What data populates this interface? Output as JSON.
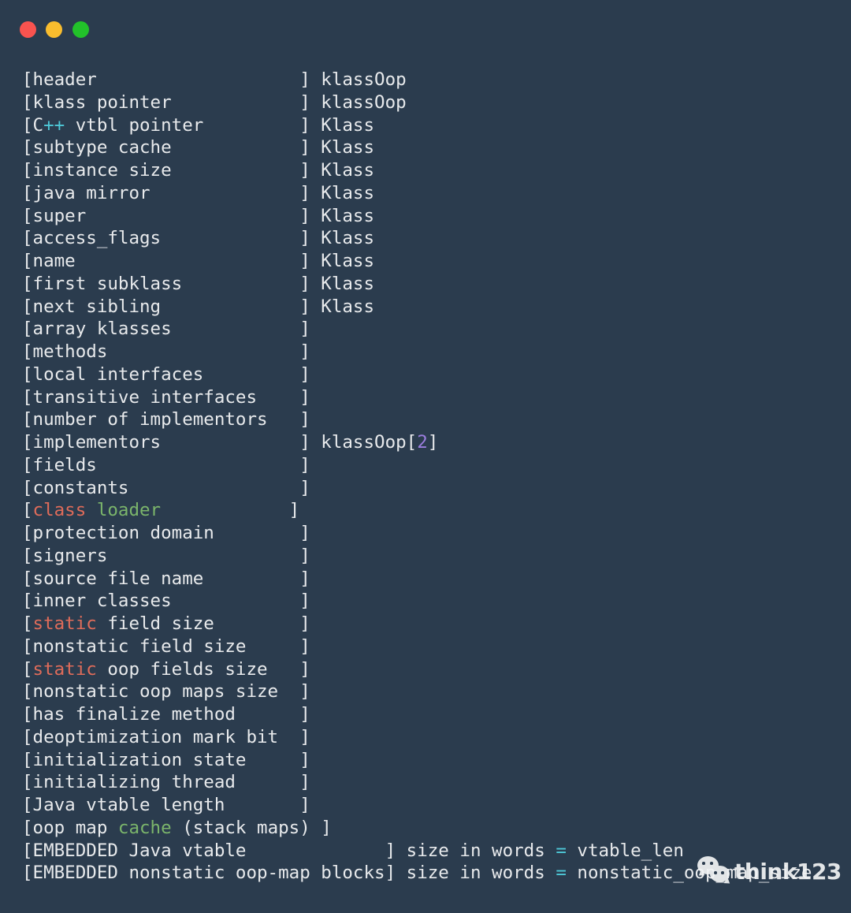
{
  "window": {
    "title": "",
    "background_color": "#2b3c4e",
    "text_color": "#e8eaec",
    "controls": {
      "close_color": "#f9534f",
      "minimize_color": "#f9bd2e",
      "maximize_color": "#22c12a",
      "close_label": "close",
      "minimize_label": "minimize",
      "maximize_label": "maximize"
    }
  },
  "colors": {
    "keyword_red": "#e06c5a",
    "keyword_green": "#7bb56b",
    "keyword_cyan": "#4ec9d8",
    "number_purple": "#9b7ede"
  },
  "terminal": {
    "lines": [
      {
        "segments": [
          {
            "t": "[header                   ] klassOop"
          }
        ]
      },
      {
        "segments": [
          {
            "t": "[klass pointer            ] klassOop"
          }
        ]
      },
      {
        "segments": [
          {
            "t": "[C"
          },
          {
            "t": "++",
            "c": "cyan"
          },
          {
            "t": " vtbl pointer         ] Klass"
          }
        ]
      },
      {
        "segments": [
          {
            "t": "[subtype cache            ] Klass"
          }
        ]
      },
      {
        "segments": [
          {
            "t": "[instance size            ] Klass"
          }
        ]
      },
      {
        "segments": [
          {
            "t": "[java mirror              ] Klass"
          }
        ]
      },
      {
        "segments": [
          {
            "t": "[super                    ] Klass"
          }
        ]
      },
      {
        "segments": [
          {
            "t": "[access_flags             ] Klass"
          }
        ]
      },
      {
        "segments": [
          {
            "t": "[name                     ] Klass"
          }
        ]
      },
      {
        "segments": [
          {
            "t": "[first subklass           ] Klass"
          }
        ]
      },
      {
        "segments": [
          {
            "t": "[next sibling             ] Klass"
          }
        ]
      },
      {
        "segments": [
          {
            "t": "[array klasses            ]"
          }
        ]
      },
      {
        "segments": [
          {
            "t": "[methods                  ]"
          }
        ]
      },
      {
        "segments": [
          {
            "t": "[local interfaces         ]"
          }
        ]
      },
      {
        "segments": [
          {
            "t": "[transitive interfaces    ]"
          }
        ]
      },
      {
        "segments": [
          {
            "t": "[number of implementors   ]"
          }
        ]
      },
      {
        "segments": [
          {
            "t": "[implementors             ] klassOop["
          },
          {
            "t": "2",
            "c": "purple"
          },
          {
            "t": "]"
          }
        ]
      },
      {
        "segments": [
          {
            "t": "[fields                   ]"
          }
        ]
      },
      {
        "segments": [
          {
            "t": "[constants                ]"
          }
        ]
      },
      {
        "segments": [
          {
            "t": "["
          },
          {
            "t": "class",
            "c": "red"
          },
          {
            "t": " "
          },
          {
            "t": "loader",
            "c": "green"
          },
          {
            "t": "            ]"
          }
        ]
      },
      {
        "segments": [
          {
            "t": "[protection domain        ]"
          }
        ]
      },
      {
        "segments": [
          {
            "t": "[signers                  ]"
          }
        ]
      },
      {
        "segments": [
          {
            "t": "[source file name         ]"
          }
        ]
      },
      {
        "segments": [
          {
            "t": "[inner classes            ]"
          }
        ]
      },
      {
        "segments": [
          {
            "t": "["
          },
          {
            "t": "static",
            "c": "red"
          },
          {
            "t": " field size        ]"
          }
        ]
      },
      {
        "segments": [
          {
            "t": "[nonstatic field size     ]"
          }
        ]
      },
      {
        "segments": [
          {
            "t": "["
          },
          {
            "t": "static",
            "c": "red"
          },
          {
            "t": " oop fields size   ]"
          }
        ]
      },
      {
        "segments": [
          {
            "t": "[nonstatic oop maps size  ]"
          }
        ]
      },
      {
        "segments": [
          {
            "t": "[has finalize method      ]"
          }
        ]
      },
      {
        "segments": [
          {
            "t": "[deoptimization mark bit  ]"
          }
        ]
      },
      {
        "segments": [
          {
            "t": "[initialization state     ]"
          }
        ]
      },
      {
        "segments": [
          {
            "t": "[initializing thread      ]"
          }
        ]
      },
      {
        "segments": [
          {
            "t": "[Java vtable length       ]"
          }
        ]
      },
      {
        "segments": [
          {
            "t": "[oop map "
          },
          {
            "t": "cache",
            "c": "green"
          },
          {
            "t": " (stack maps) ]"
          }
        ]
      },
      {
        "segments": [
          {
            "t": "[EMBEDDED Java vtable             ] size in words "
          },
          {
            "t": "=",
            "c": "cyan"
          },
          {
            "t": " vtable_len"
          }
        ]
      },
      {
        "segments": [
          {
            "t": "[EMBEDDED nonstatic oop-map blocks] size in words "
          },
          {
            "t": "=",
            "c": "cyan"
          },
          {
            "t": " nonstatic_oop_map_size"
          }
        ]
      }
    ]
  },
  "watermark": {
    "icon": "wechat-icon",
    "text": "think123"
  }
}
